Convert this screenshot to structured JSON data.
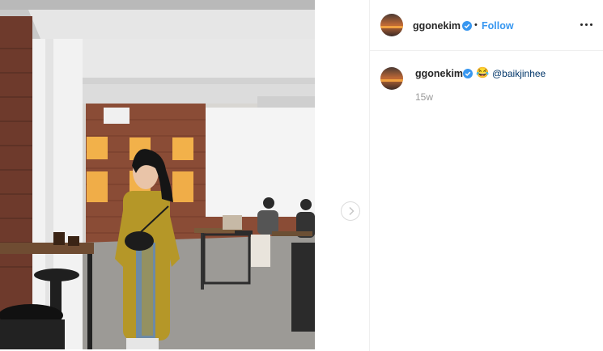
{
  "post": {
    "author": {
      "username": "ggonekim",
      "verified": true,
      "separator": "•",
      "follow_label": "Follow"
    },
    "more_icon": "more-options-icon",
    "next_icon": "chevron-right-icon",
    "caption": {
      "username": "ggonekim",
      "verified": true,
      "emoji": "😂",
      "mention": "@baikjinhee",
      "time_ago": "15w"
    }
  },
  "colors": {
    "link_blue": "#3897f0",
    "mention_blue": "#003569",
    "verified_blue": "#3897f0",
    "muted": "#999999",
    "text": "#262626",
    "border": "#efefef"
  }
}
